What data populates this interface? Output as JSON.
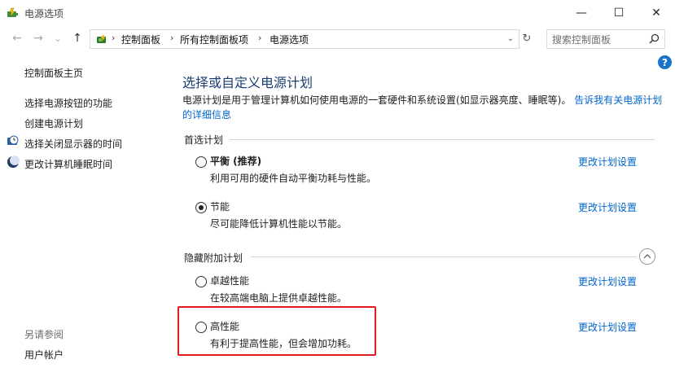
{
  "window": {
    "title": "电源选项",
    "minimize_glyph": "—",
    "maximize_glyph": "☐",
    "close_glyph": "✕"
  },
  "nav": {
    "back_glyph": "←",
    "forward_glyph": "→",
    "recent_glyph": "⌄",
    "up_glyph": "↑",
    "breadcrumbs": [
      "控制面板",
      "所有控制面板项",
      "电源选项"
    ],
    "separator": "›",
    "dropdown_glyph": "⌄",
    "refresh_glyph": "↻"
  },
  "search": {
    "placeholder": "搜索控制面板",
    "icon": "search-icon"
  },
  "help": {
    "glyph": "?"
  },
  "sidebar": {
    "home": "控制面板主页",
    "items": [
      {
        "label": "选择电源按钮的功能",
        "icon": ""
      },
      {
        "label": "创建电源计划",
        "icon": ""
      },
      {
        "label": "选择关闭显示器的时间",
        "icon": "clock-monitor-icon"
      },
      {
        "label": "更改计算机睡眠时间",
        "icon": "moon-icon"
      }
    ],
    "see_also_label": "另请参阅",
    "see_also_items": [
      "用户帐户"
    ]
  },
  "main": {
    "title": "选择或自定义电源计划",
    "description": "电源计划是用于管理计算机如何使用电源的一套硬件和系统设置(如显示器亮度、睡眠等)。",
    "description_link_line1": "告诉我有关电源计",
    "description_link_line2": "划的详细信息",
    "preferred_label": "首选计划",
    "hidden_label": "隐藏附加计划",
    "change_label": "更改计划设置",
    "plans": [
      {
        "name": "平衡 (推荐)",
        "desc": "利用可用的硬件自动平衡功耗与性能。",
        "selected": false
      },
      {
        "name": "节能",
        "desc": "尽可能降低计算机性能以节能。",
        "selected": true
      },
      {
        "name": "卓越性能",
        "desc": "在较高端电脑上提供卓越性能。",
        "selected": false
      },
      {
        "name": "高性能",
        "desc": "有利于提高性能，但会增加功耗。",
        "selected": false
      }
    ]
  },
  "colors": {
    "link": "#0066cc",
    "title": "#1a3e72",
    "highlight": "#e0191e"
  }
}
